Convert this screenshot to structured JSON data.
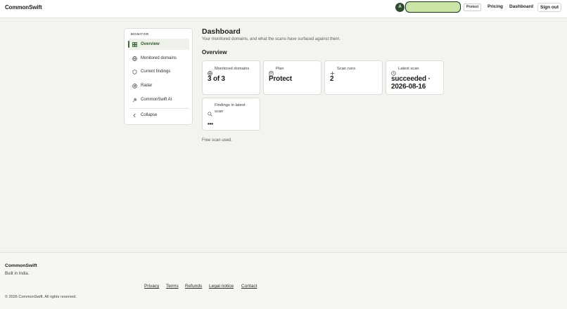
{
  "header": {
    "brand": "CommonSwift",
    "avatar_initial": "A",
    "plan_tag": "Protect",
    "nav": {
      "pricing": "Pricing",
      "dashboard": "Dashboard"
    },
    "signout_label": "Sign out",
    "accent": "#c9e6a7"
  },
  "sidebar": {
    "heading": "MONITOR",
    "items": [
      {
        "label": "Overview",
        "icon": "grid-icon",
        "active": true
      },
      {
        "label": "Monitored domains",
        "icon": "globe-icon"
      },
      {
        "label": "Current findings",
        "icon": "shield-icon"
      },
      {
        "label": "Radar",
        "icon": "radar-icon"
      },
      {
        "label": "CommonSwift AI",
        "icon": "spark-icon"
      }
    ],
    "collapse_label": "Collapse"
  },
  "main": {
    "title": "Dashboard",
    "subtitle": "Your monitored domains, and what the scans have surfaced against them.",
    "section_title": "Overview",
    "cards": [
      {
        "label": "Monitored domains",
        "value": "3 of 3",
        "icon": "globe-icon"
      },
      {
        "label": "Plan",
        "value": "Protect",
        "icon": "box-icon"
      },
      {
        "label": "Scan runs",
        "value": "2",
        "icon": "plus-icon"
      },
      {
        "label": "Latest scan",
        "value_line1": "succeeded ·",
        "value_line2": "2026-08-16",
        "icon": "clock-icon"
      },
      {
        "label_line1": "Findings in latest",
        "label_line2": "scan",
        "value": "•••",
        "icon": "search-icon"
      }
    ],
    "note": "Free scan used."
  },
  "footer": {
    "brand": "CommonSwift",
    "tagline": "Built in India.",
    "links": [
      "Privacy",
      "Terms",
      "Refunds",
      "Legal notice",
      "Contact"
    ],
    "copyright": "© 2026 CommonSwift. All rights reserved."
  }
}
